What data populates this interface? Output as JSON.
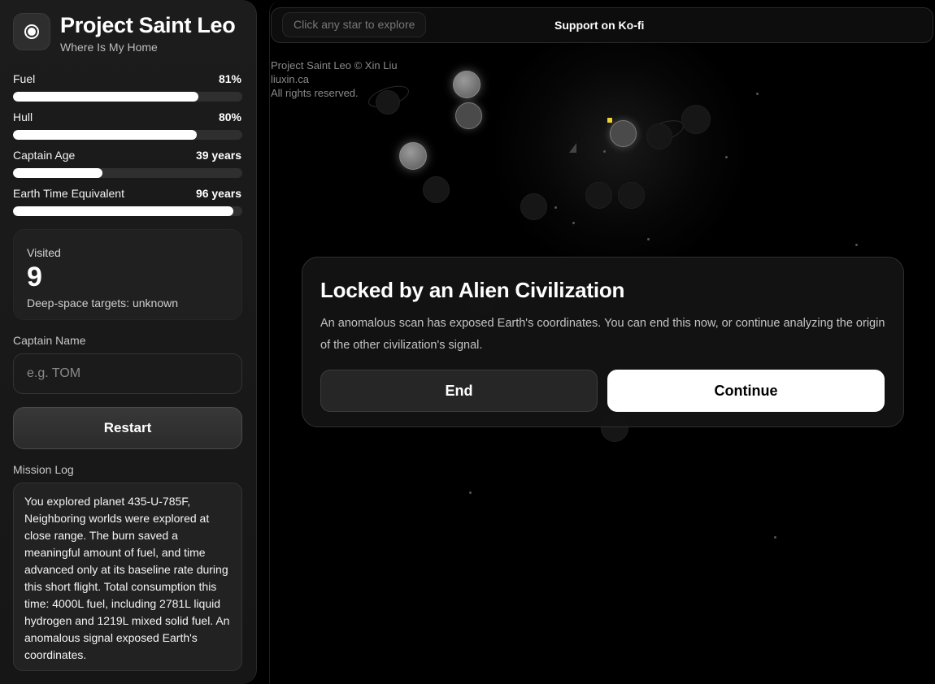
{
  "brand": {
    "icon": "ship-target-icon",
    "title": "Project Saint Leo",
    "subtitle": "Where Is My Home"
  },
  "stats": [
    {
      "label": "Fuel",
      "value": "81%",
      "fraction": 0.81
    },
    {
      "label": "Hull",
      "value": "80%",
      "fraction": 0.8
    },
    {
      "label": "Captain Age",
      "value": "39 years",
      "fraction": 0.39
    },
    {
      "label": "Earth Time Equivalent",
      "value": "96 years",
      "fraction": 0.96
    }
  ],
  "visited": {
    "label": "Visited",
    "count": "9",
    "note": "Deep-space targets: unknown"
  },
  "captain": {
    "label": "Captain Name",
    "placeholder": "e.g. TOM",
    "value": ""
  },
  "restart_label": "Restart",
  "mission_log": {
    "label": "Mission Log",
    "text": "You explored planet 435-U-785F, Neighboring worlds were explored at close range. The burn saved a meaningful amount of fuel, and time advanced only at its baseline rate during this short flight. Total consumption this time: 4000L fuel, including 2781L liquid hydrogen and 1219L mixed solid fuel. An anomalous signal exposed Earth's coordinates."
  },
  "topbar": {
    "hint": "Click any star to explore",
    "support_label": "Support on Ko-fi"
  },
  "credits": {
    "line1": "Project Saint Leo © Xin Liu",
    "line2": "liuxin.ca",
    "line3": "All rights reserved."
  },
  "modal": {
    "title": "Locked by an Alien Civilization",
    "body": "An anomalous scan has exposed Earth's coordinates. You can end this now, or continue analyzing the origin of the other civilization's signal.",
    "end_label": "End",
    "continue_label": "Continue"
  },
  "colors": {
    "accent": "#ffffff",
    "marker": "#f2d22e",
    "background": "#000000",
    "panel": "#1c1c1c"
  }
}
